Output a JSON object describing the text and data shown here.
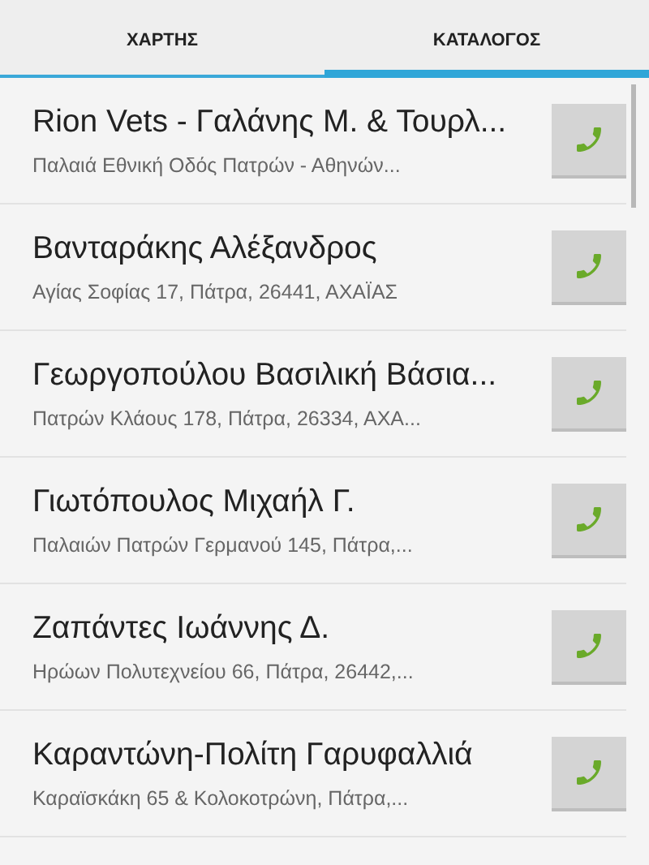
{
  "tabs": [
    {
      "label": "ΧΑΡΤΗΣ",
      "selected": false
    },
    {
      "label": "ΚΑΤΑΛΟΓΟΣ",
      "selected": true
    }
  ],
  "entries": [
    {
      "name": "Rion Vets - Γαλάνης Μ. & Τουρλ...",
      "address": "Παλαιά Εθνική Οδός Πατρών - Αθηνών..."
    },
    {
      "name": "Βανταράκης Αλέξανδρος",
      "address": "Αγίας Σοφίας 17, Πάτρα, 26441, ΑΧΑΪΑΣ"
    },
    {
      "name": "Γεωργοπούλου Βασιλική Βάσια...",
      "address": "Πατρών Κλάους 178, Πάτρα, 26334, ΑΧΑ..."
    },
    {
      "name": "Γιωτόπουλος Μιχαήλ Γ.",
      "address": "Παλαιών Πατρών Γερμανού 145, Πάτρα,..."
    },
    {
      "name": "Ζαπάντες Ιωάννης Δ.",
      "address": "Ηρώων Πολυτεχνείου 66, Πάτρα, 26442,..."
    },
    {
      "name": "Καραντώνη-Πολίτη Γαρυφαλλιά",
      "address": "Καραϊσκάκη 65 & Κολοκοτρώνη, Πάτρα,..."
    }
  ]
}
